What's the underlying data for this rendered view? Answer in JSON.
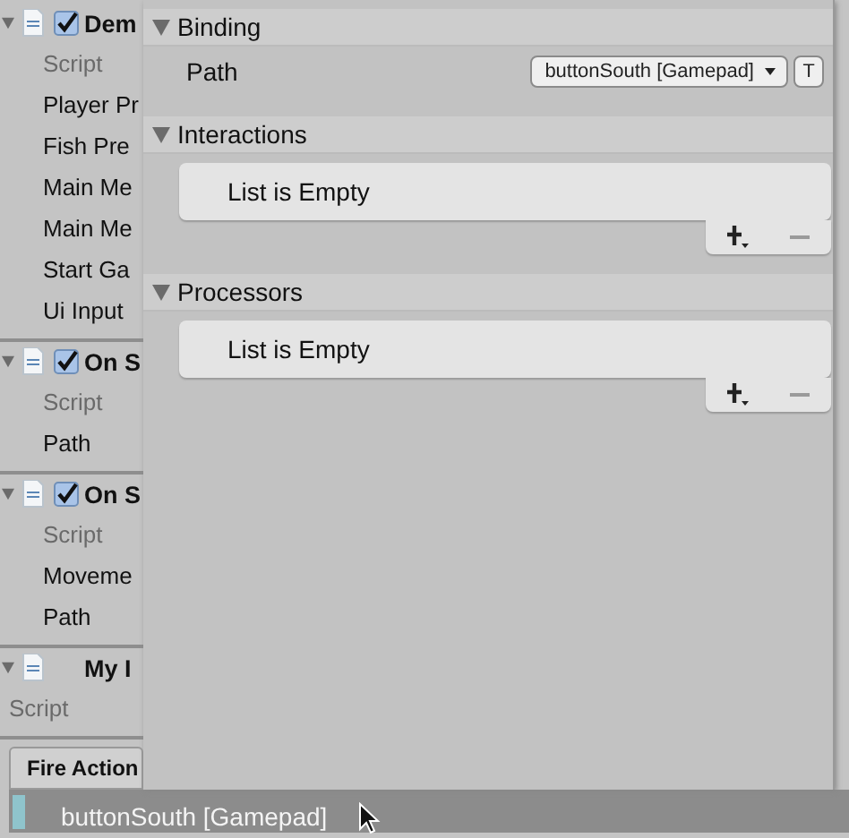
{
  "inspector": {
    "components": [
      {
        "title": "Dem",
        "kind": "toggle",
        "checked": true,
        "expanded": true,
        "fields": [
          {
            "label": "Script",
            "kind": "script"
          },
          {
            "label": "Player Pr",
            "kind": "field"
          },
          {
            "label": "Fish Pre",
            "kind": "field"
          },
          {
            "label": "Main Me",
            "kind": "field"
          },
          {
            "label": "Main Me",
            "kind": "field"
          },
          {
            "label": "Start Ga",
            "kind": "field"
          },
          {
            "label": "Ui Input",
            "kind": "field"
          }
        ]
      },
      {
        "title": "On S",
        "kind": "toggle",
        "checked": true,
        "expanded": true,
        "fields": [
          {
            "label": "Script",
            "kind": "script"
          },
          {
            "label": "Path",
            "kind": "field"
          }
        ]
      },
      {
        "title": "On S",
        "kind": "toggle",
        "checked": true,
        "expanded": true,
        "fields": [
          {
            "label": "Script",
            "kind": "script"
          },
          {
            "label": "Moveme",
            "kind": "field"
          },
          {
            "label": "Path",
            "kind": "field"
          }
        ]
      },
      {
        "title": "My I",
        "kind": "plain",
        "expanded": true,
        "fields": [
          {
            "label": "Script",
            "kind": "script"
          }
        ]
      }
    ],
    "list": {
      "header": "Fire Action",
      "rows": [
        {
          "label": "buttonSouth [Gamepad]",
          "selected": true
        }
      ]
    }
  },
  "popup": {
    "sections": [
      {
        "title": "Binding",
        "expanded": true,
        "kind": "properties",
        "rows": [
          {
            "label": "Path",
            "value": "buttonSouth [Gamepad]",
            "button": "T"
          }
        ]
      },
      {
        "title": "Interactions",
        "expanded": true,
        "kind": "list",
        "empty_text": "List is Empty"
      },
      {
        "title": "Processors",
        "expanded": true,
        "kind": "list",
        "empty_text": "List is Empty"
      }
    ]
  }
}
